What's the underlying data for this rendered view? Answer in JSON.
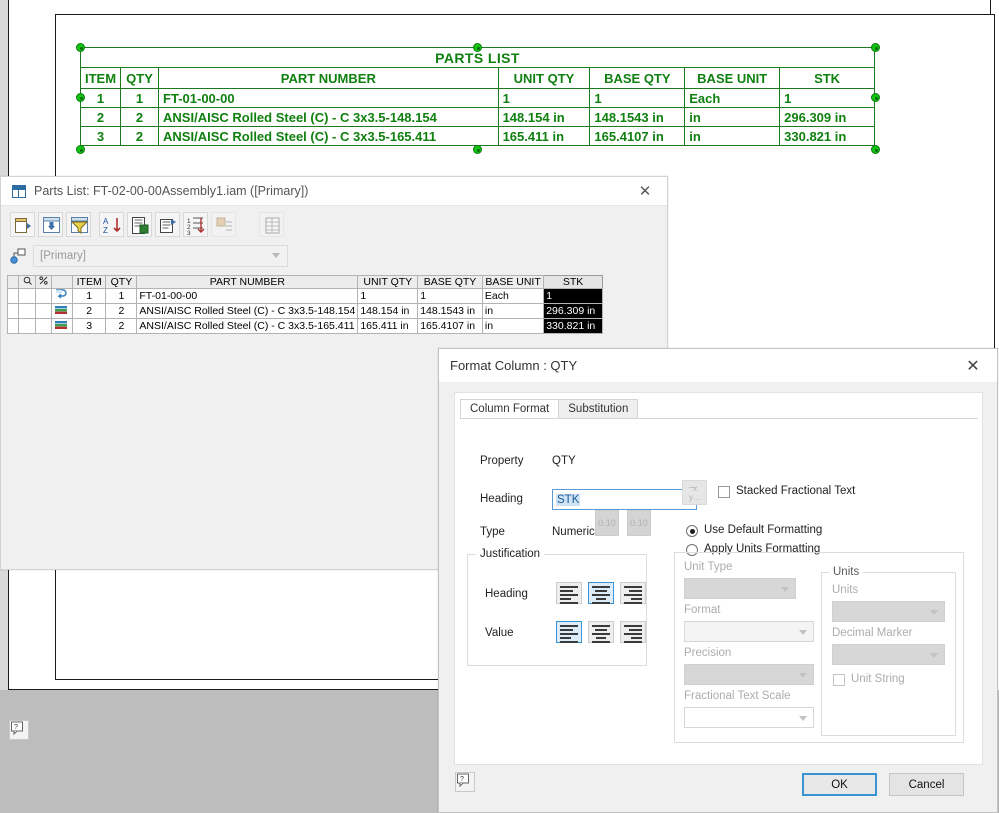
{
  "cad": {
    "parts_list": {
      "title": "PARTS LIST",
      "columns": [
        "ITEM",
        "QTY",
        "PART NUMBER",
        "UNIT QTY",
        "BASE QTY",
        "BASE UNIT",
        "STK"
      ],
      "rows": [
        [
          "1",
          "1",
          "FT-01-00-00",
          "1",
          "1",
          "Each",
          "1"
        ],
        [
          "2",
          "2",
          "ANSI/AISC Rolled Steel (C) - C 3x3.5-148.154",
          "148.154 in",
          "148.1543 in",
          "in",
          "296.309 in"
        ],
        [
          "3",
          "2",
          "ANSI/AISC Rolled Steel (C) - C 3x3.5-165.411",
          "165.411 in",
          "165.4107 in",
          "in",
          "330.821 in"
        ]
      ]
    }
  },
  "parts_list_window": {
    "title": "Parts List: FT-02-00-00Assembly1.iam ([Primary])",
    "icon": "table-icon",
    "close_icon": "close-icon",
    "toolbar": [
      {
        "name": "column-chooser-icon",
        "label": "Column Chooser"
      },
      {
        "name": "group-settings-icon",
        "label": "Group Settings"
      },
      {
        "name": "filter-settings-icon",
        "label": "Filter Settings"
      },
      {
        "name": "sort-icon",
        "label": "Sort"
      },
      {
        "name": "export-icon",
        "label": "Export"
      },
      {
        "name": "properties-icon",
        "label": "Column Properties"
      },
      {
        "name": "renumber-icon",
        "label": "Renumber Items"
      },
      {
        "name": "save-item-overrides-icon",
        "label": "Save Item Overrides"
      },
      {
        "name": "table-layout-icon",
        "label": "Table Layout"
      }
    ],
    "view_selector": {
      "icon": "structure-icon",
      "value": "[Primary]"
    },
    "grid": {
      "columns": [
        "",
        "",
        "",
        "",
        "ITEM",
        "QTY",
        "PART NUMBER",
        "UNIT QTY",
        "BASE QTY",
        "BASE UNIT",
        "STK"
      ],
      "selected_column": "STK",
      "rows": [
        {
          "icon": "static-part-icon",
          "item": "1",
          "qty": "1",
          "part_number": "FT-01-00-00",
          "unit_qty": "1",
          "base_qty": "1",
          "base_unit": "Each",
          "stk": "1"
        },
        {
          "icon": "structural-shape-icon",
          "item": "2",
          "qty": "2",
          "part_number": "ANSI/AISC Rolled Steel (C) - C 3x3.5-148.154",
          "unit_qty": "148.154 in",
          "base_qty": "148.1543 in",
          "base_unit": "in",
          "stk": "296.309 in"
        },
        {
          "icon": "structural-shape-icon",
          "item": "3",
          "qty": "2",
          "part_number": "ANSI/AISC Rolled Steel (C) - C 3x3.5-165.411",
          "unit_qty": "165.411 in",
          "base_qty": "165.4107 in",
          "base_unit": "in",
          "stk": "330.821 in"
        }
      ]
    },
    "help_icon": "help-icon"
  },
  "format_dialog": {
    "title": "Format Column : QTY",
    "close_icon": "close-icon",
    "tabs": [
      {
        "label": "Column Format",
        "active": true
      },
      {
        "label": "Substitution",
        "active": false
      }
    ],
    "property_label": "Property",
    "property_value": "QTY",
    "heading_label": "Heading",
    "heading_value": "STK",
    "stacked_fractional_label": "Stacked Fractional Text",
    "stacked_fractional_checked": false,
    "fraction_button_icon": "stacked-fraction-icon",
    "type_label": "Type",
    "type_value": "Numeric",
    "formatting_mode": "Use Default Formatting",
    "radios": [
      {
        "label": "Use Default Formatting",
        "selected": true
      },
      {
        "label": "Apply Units Formatting",
        "selected": false
      }
    ],
    "preview_boxes": [
      "0.10",
      "0.10"
    ],
    "justification": {
      "group_label": "Justification",
      "rows": [
        {
          "label": "Heading",
          "selected": "center"
        },
        {
          "label": "Value",
          "selected": "left"
        }
      ]
    },
    "units_formatting": {
      "unit_type_label": "Unit Type",
      "unit_type_value": "",
      "format_label": "Format",
      "format_value": "",
      "precision_label": "Precision",
      "precision_value": "",
      "fractional_text_scale_label": "Fractional Text Scale",
      "fractional_text_scale_value": ""
    },
    "units_group": {
      "group_label": "Units",
      "units_label": "Units",
      "units_value": "",
      "decimal_marker_label": "Decimal Marker",
      "decimal_marker_value": "",
      "unit_string_label": "Unit String",
      "unit_string_checked": false
    },
    "help_icon": "help-icon",
    "ok_label": "OK",
    "cancel_label": "Cancel",
    "focused_button": "OK"
  },
  "colors": {
    "cad_green": "#108010",
    "accent_blue": "#3b93d4",
    "selection_blue": "#cfe3f5",
    "selection_black": "#000000"
  }
}
